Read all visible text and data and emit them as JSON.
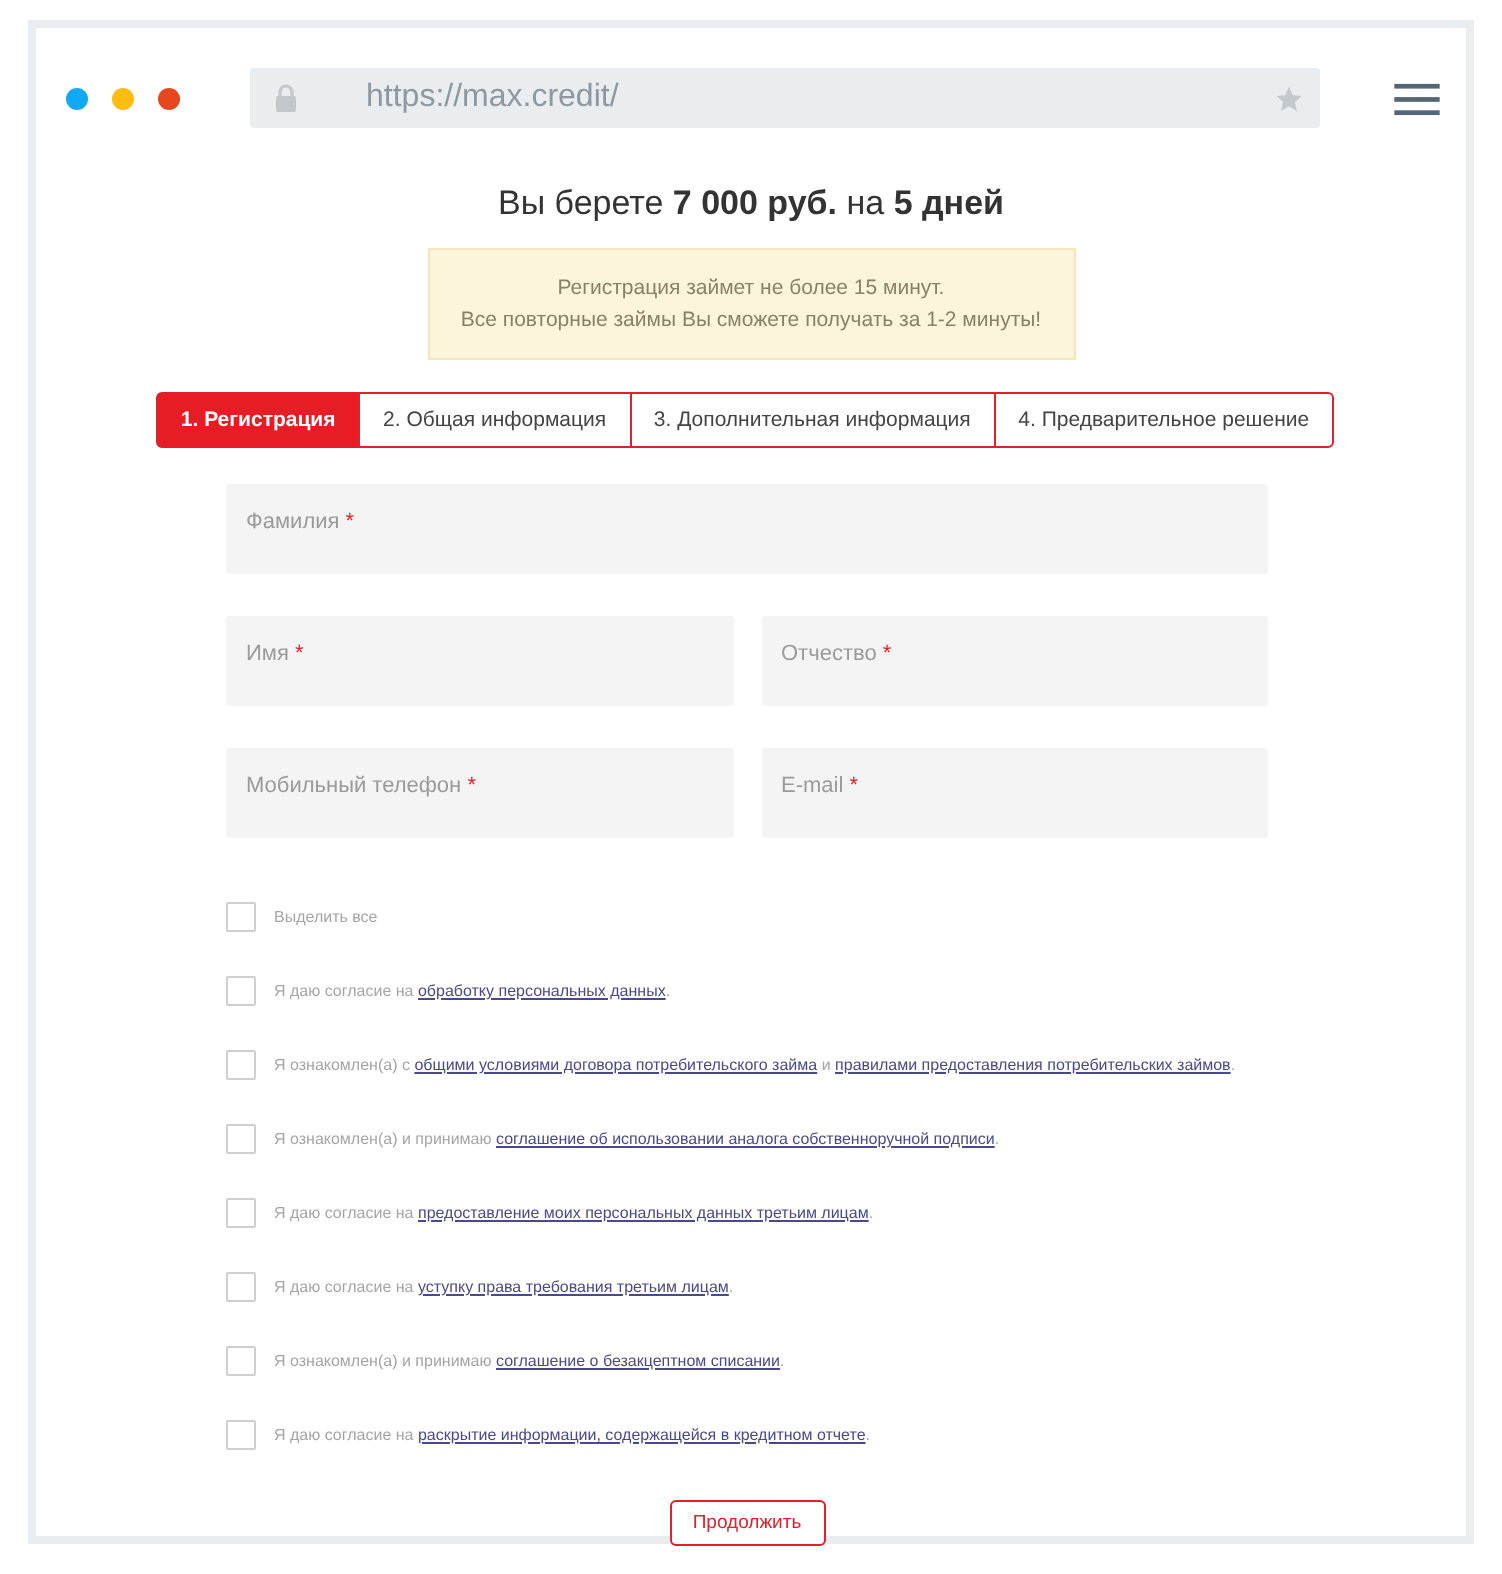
{
  "browser": {
    "url": "https://max.credit/"
  },
  "heading": "Вы берете **7 000 руб.** на **5 дней**",
  "notice": [
    "Регистрация займет не более 15 минут.",
    "Все повторные займы Вы сможете получать за 1-2 минуты!"
  ],
  "tabs": [
    {
      "label": "1. Регистрация",
      "selected": true
    },
    {
      "label": "2. Общая информация",
      "selected": false
    },
    {
      "label": "3. Дополнительная информация",
      "selected": false
    },
    {
      "label": "4. Предварительное решение",
      "selected": false
    }
  ],
  "field_rows": [
    [
      {
        "placeholder": "Фамилия",
        "required_mark": "*"
      }
    ],
    [
      {
        "placeholder": "Имя",
        "required_mark": "*"
      },
      {
        "placeholder": "Отчество",
        "required_mark": "*"
      }
    ],
    [
      {
        "placeholder": "Мобильный телефон",
        "required_mark": "*"
      },
      {
        "placeholder": "E-mail",
        "required_mark": "*"
      }
    ]
  ],
  "consents": [
    {
      "checked": false,
      "parts": [
        {
          "kind": "plain",
          "text": "Выделить все"
        }
      ]
    },
    {
      "checked": false,
      "parts": [
        {
          "kind": "plain",
          "text": "Я даю согласие на"
        },
        {
          "kind": "link",
          "text": "обработку персональных данных"
        },
        {
          "kind": "plain",
          "text": "."
        }
      ]
    },
    {
      "checked": false,
      "parts": [
        {
          "kind": "plain",
          "text": "Я ознакомлен(а) с"
        },
        {
          "kind": "link",
          "text": "общими условиями договора потребительского займа"
        },
        {
          "kind": "plain",
          "text": "и"
        },
        {
          "kind": "link",
          "text": "правилами предоставления потребительских займов"
        },
        {
          "kind": "plain",
          "text": "."
        }
      ]
    },
    {
      "checked": false,
      "parts": [
        {
          "kind": "plain",
          "text": "Я ознакомлен(а) и принимаю"
        },
        {
          "kind": "link",
          "text": "соглашение об использовании аналога собственноручной подписи"
        },
        {
          "kind": "plain",
          "text": "."
        }
      ]
    },
    {
      "checked": false,
      "parts": [
        {
          "kind": "plain",
          "text": "Я даю согласие на"
        },
        {
          "kind": "link",
          "text": "предоставление моих персональных данных третьим лицам"
        },
        {
          "kind": "plain",
          "text": "."
        }
      ]
    },
    {
      "checked": false,
      "parts": [
        {
          "kind": "plain",
          "text": "Я даю согласие на"
        },
        {
          "kind": "link",
          "text": "уступку права требования третьим лицам"
        },
        {
          "kind": "plain",
          "text": "."
        }
      ]
    },
    {
      "checked": false,
      "parts": [
        {
          "kind": "plain",
          "text": "Я ознакомлен(а) и принимаю"
        },
        {
          "kind": "link",
          "text": "соглашение о безакцептном списании"
        },
        {
          "kind": "plain",
          "text": "."
        }
      ]
    },
    {
      "checked": false,
      "parts": [
        {
          "kind": "plain",
          "text": "Я даю согласие на"
        },
        {
          "kind": "link",
          "text": "раскрытие информации, содержащейся в кредитном отчете"
        },
        {
          "kind": "plain",
          "text": "."
        }
      ]
    }
  ],
  "submit": "Продолжить"
}
